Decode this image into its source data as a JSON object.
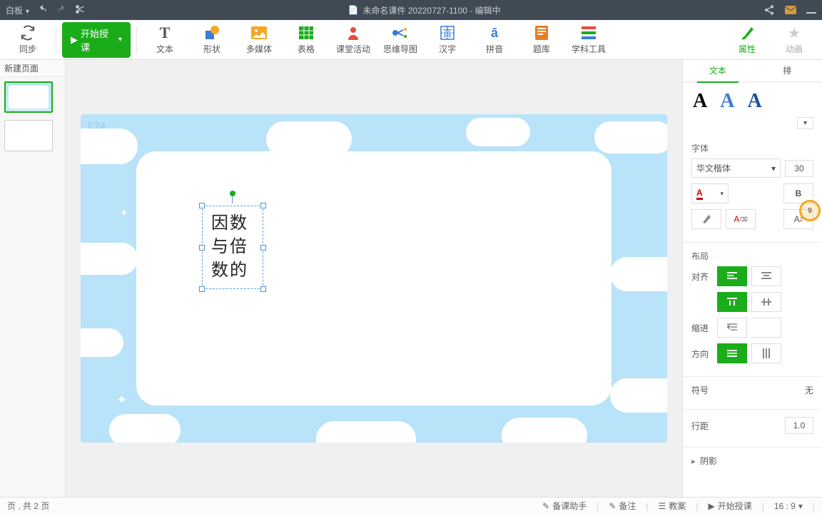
{
  "titlebar": {
    "board_label": "白板",
    "doc_title": "未命名课件 20220727-1100 - 编辑中"
  },
  "ribbon": {
    "sync": "同步",
    "start": "开始授课",
    "text": "文本",
    "shape": "形状",
    "media": "多媒体",
    "table": "表格",
    "activity": "课堂活动",
    "mindmap": "思维导图",
    "hanzi": "汉字",
    "pinyin": "拼音",
    "bank": "题库",
    "tools": "学科工具",
    "props": "属性",
    "anim": "动画"
  },
  "nav": {
    "newpage": "新建页面"
  },
  "slide": {
    "tag": "E24",
    "textbox": "因数与倍数的"
  },
  "panel": {
    "tab_text": "文本",
    "tab_arrange": "排",
    "font_section": "字体",
    "font_family": "华文楷体",
    "font_size": "30",
    "layout_section": "布局",
    "align_label": "对齐",
    "indent_label": "缩进",
    "direction_label": "方向",
    "symbol_section": "符号",
    "symbol_none": "无",
    "lineheight_label": "行距",
    "lineheight_val": "1.0",
    "shadow_label": "阴影",
    "marker": "9"
  },
  "status": {
    "pageinfo": "页 , 共 2 页",
    "helper": "备课助手",
    "note": "备注",
    "plan": "教案",
    "start": "开始授课",
    "ratio": "16 : 9"
  }
}
